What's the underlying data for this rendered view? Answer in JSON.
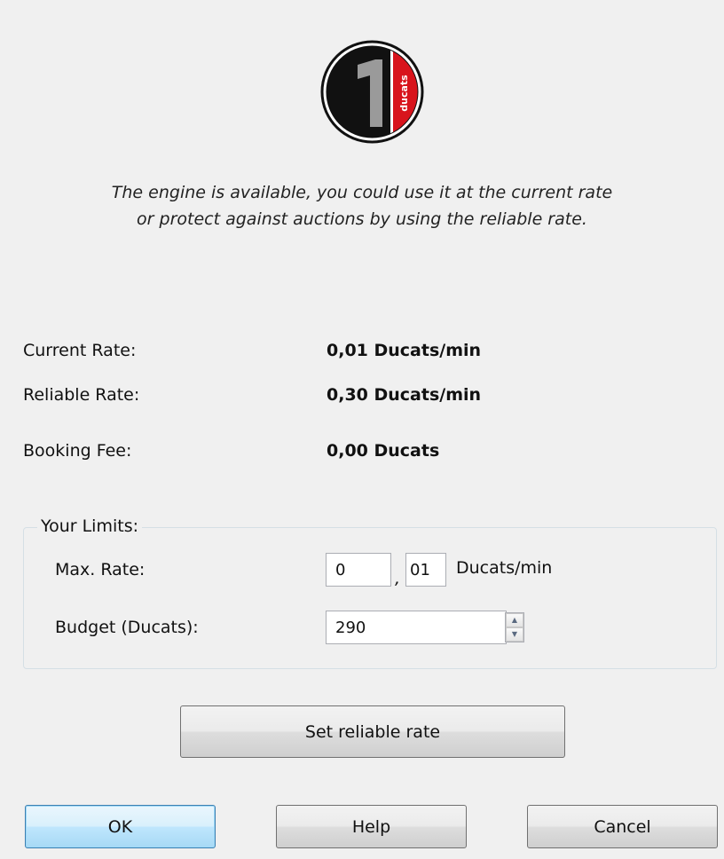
{
  "logo": {
    "numeral": "1",
    "brand": "ducats",
    "colors": {
      "ring": "#111111",
      "numeral": "#9a9a9a",
      "band": "#d8141c"
    }
  },
  "message": {
    "line1": "The engine is available, you could use it at the current rate",
    "line2": "or protect against auctions by using the reliable rate."
  },
  "rates": [
    {
      "label": "Current Rate:",
      "value": "0,01 Ducats/min"
    },
    {
      "label": "Reliable Rate:",
      "value": "0,30 Ducats/min"
    },
    {
      "label": "Booking Fee:",
      "value": "0,00 Ducats"
    }
  ],
  "limits": {
    "legend": "Your Limits:",
    "max_rate_label": "Max. Rate:",
    "max_rate_whole": "0",
    "decimal_separator": ",",
    "max_rate_fraction": "01",
    "max_rate_unit": "Ducats/min",
    "budget_label": "Budget (Ducats):",
    "budget_value": "290"
  },
  "buttons": {
    "set_reliable": "Set reliable rate",
    "ok": "OK",
    "help": "Help",
    "cancel": "Cancel"
  }
}
